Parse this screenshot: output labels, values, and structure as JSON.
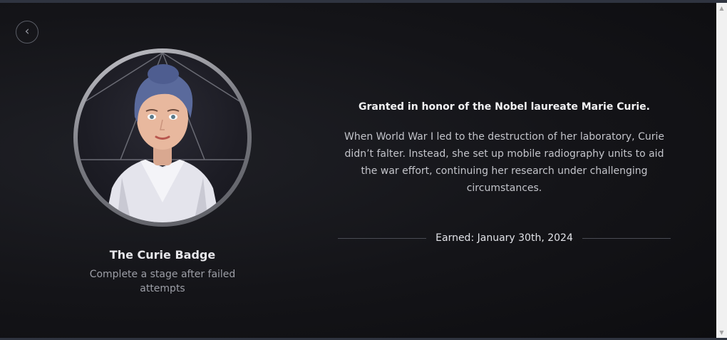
{
  "navigation": {
    "back_icon": "‹"
  },
  "badge": {
    "name": "The Curie Badge",
    "requirement": "Complete a stage after failed attempts",
    "portrait_icon": "marie-curie-avatar"
  },
  "details": {
    "honor": "Granted in honor of the Nobel laureate Marie Curie.",
    "story": "When World War I led to the destruction of her laboratory, Curie didn’t falter. Instead, she set up mobile radiography units to aid the war effort, continuing her research under challenging circumstances.",
    "earned": "Earned: January 30th, 2024"
  },
  "scrollbar": {
    "up_icon": "▲",
    "down_icon": "▼"
  },
  "colors": {
    "background": "#141418",
    "ring": "#9a9ba2",
    "text_primary": "#f2f2f4",
    "text_secondary": "#9c9ea6"
  }
}
